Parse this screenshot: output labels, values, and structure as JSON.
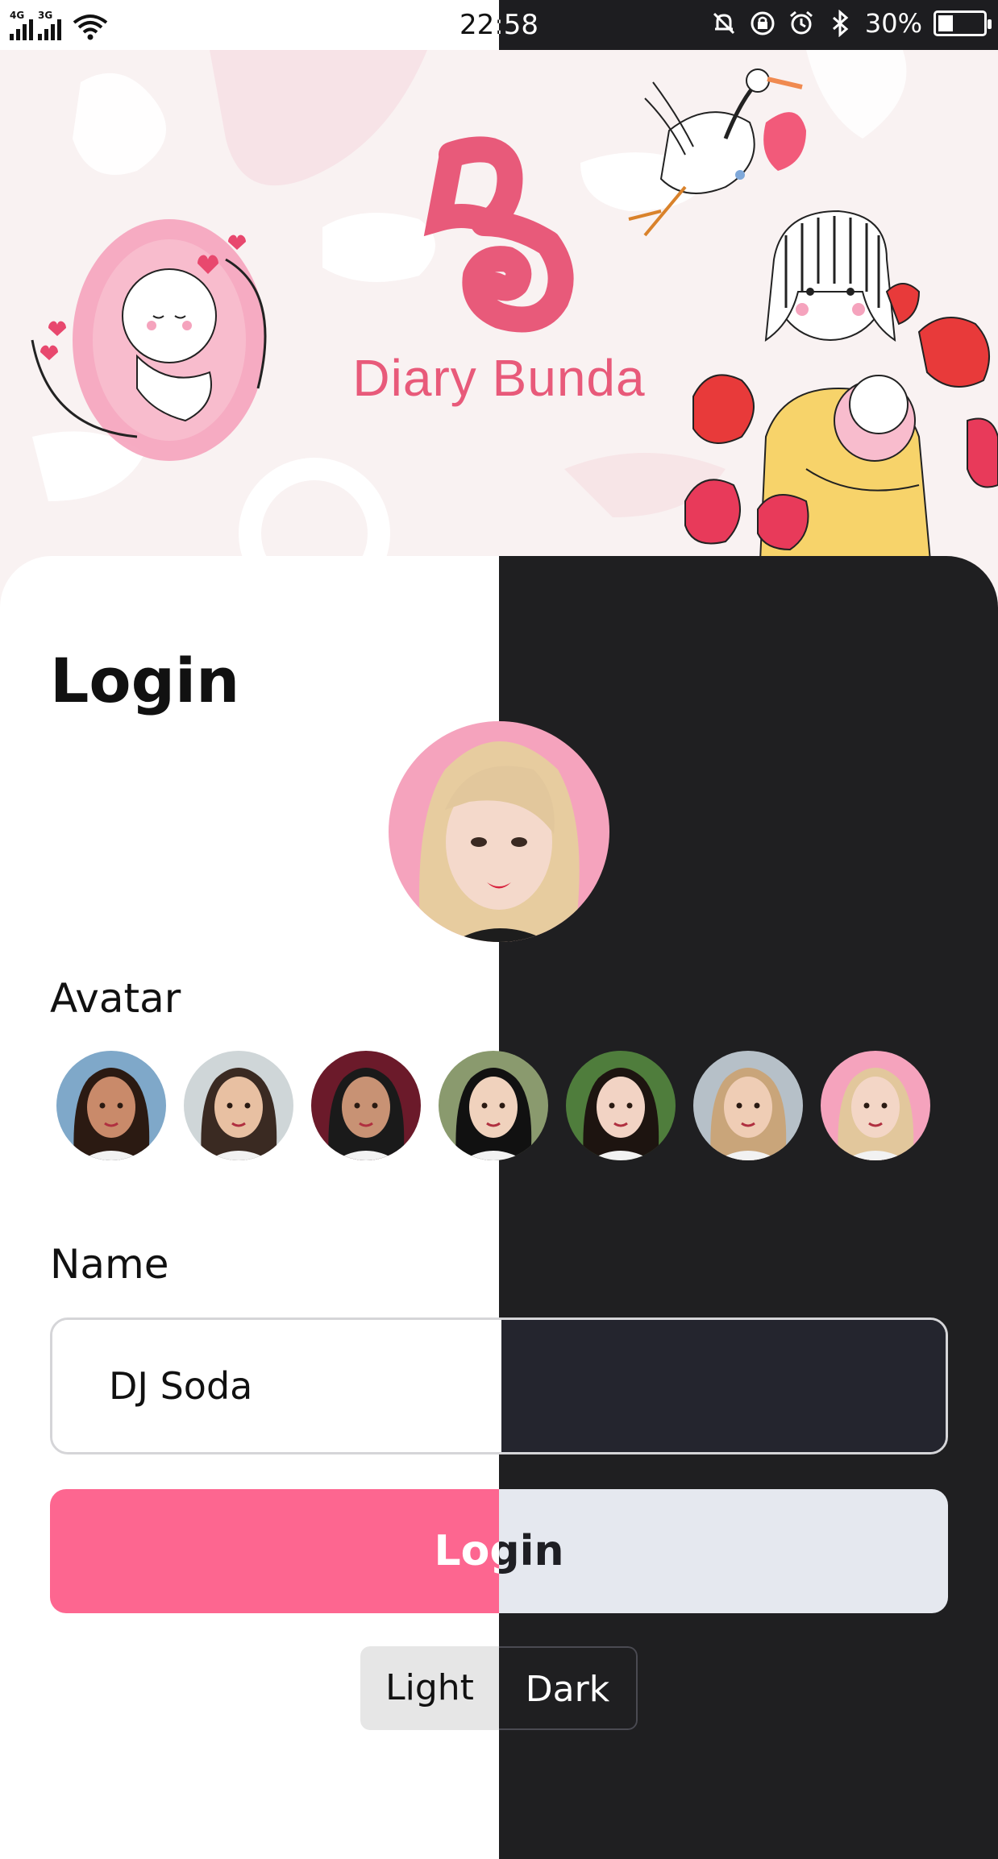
{
  "status_bar": {
    "network_1": "4G",
    "network_2": "3G",
    "time": "22:58",
    "battery_percent": "30%",
    "battery_level": 0.3,
    "icons": [
      "signal-icon",
      "wifi-icon",
      "mute-icon",
      "rotation-lock-icon",
      "alarm-icon",
      "bluetooth-icon",
      "battery-icon"
    ]
  },
  "banner": {
    "brand_name": "Diary Bunda",
    "logo_letter": "B"
  },
  "login": {
    "title": "Login",
    "avatar_label": "Avatar",
    "avatars": [
      {
        "name": "avatar-1",
        "bg": "#7fa8c9",
        "skin": "#c98a6a",
        "hair": "#2b1a12"
      },
      {
        "name": "avatar-2",
        "bg": "#cfd6d8",
        "skin": "#e8c0a2",
        "hair": "#3a2a22"
      },
      {
        "name": "avatar-3",
        "bg": "#6b1a2a",
        "skin": "#c89274",
        "hair": "#1a1a1a"
      },
      {
        "name": "avatar-4",
        "bg": "#8a9a6e",
        "skin": "#f0d2bd",
        "hair": "#111111"
      },
      {
        "name": "avatar-5",
        "bg": "#4f7d3c",
        "skin": "#f2d3c4",
        "hair": "#1d1410"
      },
      {
        "name": "avatar-6",
        "bg": "#b6c0c8",
        "skin": "#efcdb5",
        "hair": "#c9a57a"
      },
      {
        "name": "avatar-7",
        "bg": "#f5a3bd",
        "skin": "#f3d6c6",
        "hair": "#e2c79c"
      }
    ],
    "selected_avatar_index": 6,
    "name_label": "Name",
    "name_value": "DJ Soda",
    "login_button": "Login",
    "theme_light": "Light",
    "theme_dark": "Dark",
    "colors": {
      "accent": "#fd6690",
      "dark_bg": "#1f1f21",
      "brand": "#e85a7a"
    }
  }
}
